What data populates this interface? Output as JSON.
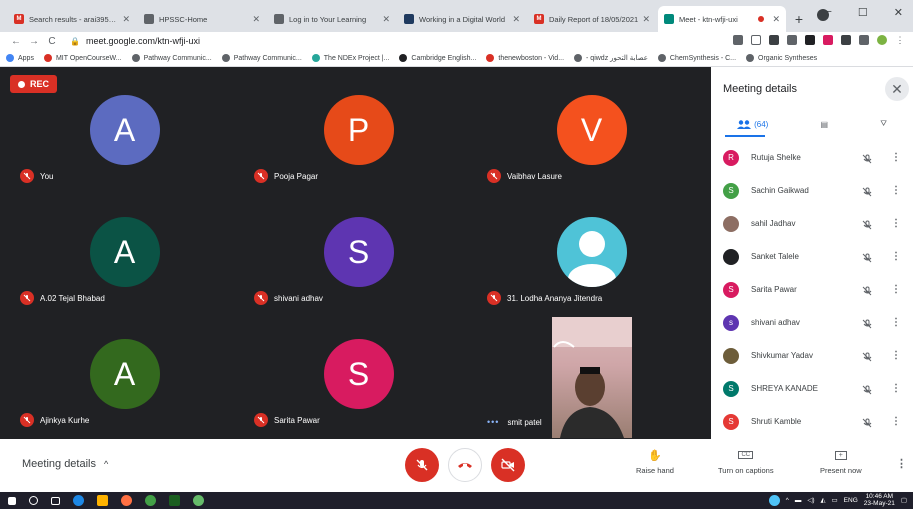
{
  "browser": {
    "tabs": [
      {
        "title": "Search results - arai3954@",
        "favicon_color": "#d93025",
        "favicon_letter": "M",
        "active": false
      },
      {
        "title": "HPSSC-Home",
        "favicon_color": "#5f6368",
        "favicon_letter": "",
        "active": false
      },
      {
        "title": "Log in to Your Learning",
        "favicon_color": "#5f6368",
        "favicon_letter": "",
        "active": false
      },
      {
        "title": "Working in a Digital World",
        "favicon_color": "#1f3a5f",
        "favicon_letter": "",
        "active": false
      },
      {
        "title": "Daily Report of 18/05/2021",
        "favicon_color": "#d93025",
        "favicon_letter": "M",
        "active": false
      },
      {
        "title": "Meet - ktn-wfji-uxi",
        "favicon_color": "#00897b",
        "favicon_letter": "",
        "active": true
      }
    ],
    "new_tab_label": "+",
    "url": "meet.google.com/ktn-wfji-uxi",
    "bookmarks": [
      {
        "label": "Apps",
        "color": "#4285f4"
      },
      {
        "label": "MIT OpenCourseW...",
        "color": "#d93025"
      },
      {
        "label": "Pathway Communic...",
        "color": "#5f6368"
      },
      {
        "label": "Pathway Communic...",
        "color": "#5f6368"
      },
      {
        "label": "The NDEx Project |...",
        "color": "#26a69a"
      },
      {
        "label": "Cambridge English...",
        "color": "#202124"
      },
      {
        "label": "thenewboston - Vid...",
        "color": "#d93025"
      },
      {
        "label": "- qiwdz عصابة التحور",
        "color": "#5f6368"
      },
      {
        "label": "ChemSynthesis - C...",
        "color": "#5f6368"
      },
      {
        "label": "Organic Syntheses",
        "color": "#5f6368"
      }
    ]
  },
  "meet": {
    "rec_label": "REC",
    "tiles": [
      {
        "name": "You",
        "initial": "A",
        "color": "#5c6bc0",
        "type": "letter",
        "muted": true
      },
      {
        "name": "Pooja Pagar",
        "initial": "P",
        "color": "#e64a19",
        "type": "letter",
        "muted": true
      },
      {
        "name": "Vaibhav Lasure",
        "initial": "V",
        "color": "#f4511e",
        "type": "letter",
        "muted": true
      },
      {
        "name": "A.02 Tejal Bhabad",
        "initial": "A",
        "color": "#0b5345",
        "type": "letter",
        "muted": true
      },
      {
        "name": "shivani adhav",
        "initial": "S",
        "color": "#5e35b1",
        "type": "letter",
        "muted": true
      },
      {
        "name": "31. Lodha Ananya Jitendra",
        "initial": "",
        "color": "#4fc3d7",
        "type": "silhouette",
        "muted": true
      },
      {
        "name": "Ajinkya Kurhe",
        "initial": "A",
        "color": "#33691e",
        "type": "letter",
        "muted": true
      },
      {
        "name": "Sarita Pawar",
        "initial": "S",
        "color": "#d81b60",
        "type": "letter",
        "muted": true
      },
      {
        "name": "smit patel",
        "initial": "",
        "color": "#202124",
        "type": "video",
        "muted": false
      }
    ]
  },
  "panel": {
    "title": "Meeting details",
    "people_count": "(64)",
    "participants": [
      {
        "name": "Rutuja Shelke",
        "initial": "R",
        "color": "#d81b60"
      },
      {
        "name": "Sachin Gaikwad",
        "initial": "S",
        "color": "#43a047"
      },
      {
        "name": "sahil Jadhav",
        "initial": "",
        "color": "#8d6e63"
      },
      {
        "name": "Sanket Talele",
        "initial": "",
        "color": "#202124"
      },
      {
        "name": "Sarita Pawar",
        "initial": "S",
        "color": "#d81b60"
      },
      {
        "name": "shivani adhav",
        "initial": "s",
        "color": "#5e35b1"
      },
      {
        "name": "Shivkumar Yadav",
        "initial": "",
        "color": "#6d5d3a"
      },
      {
        "name": "SHREYA KANADE",
        "initial": "S",
        "color": "#00796b"
      },
      {
        "name": "Shruti Kamble",
        "initial": "S",
        "color": "#e53935"
      }
    ]
  },
  "bottom": {
    "meeting_details_label": "Meeting details",
    "raise_hand_label": "Raise hand",
    "captions_label": "Turn on captions",
    "present_label": "Present now"
  },
  "taskbar": {
    "time": "10:46 AM",
    "date": "23-May-21",
    "lang": "ENG"
  }
}
